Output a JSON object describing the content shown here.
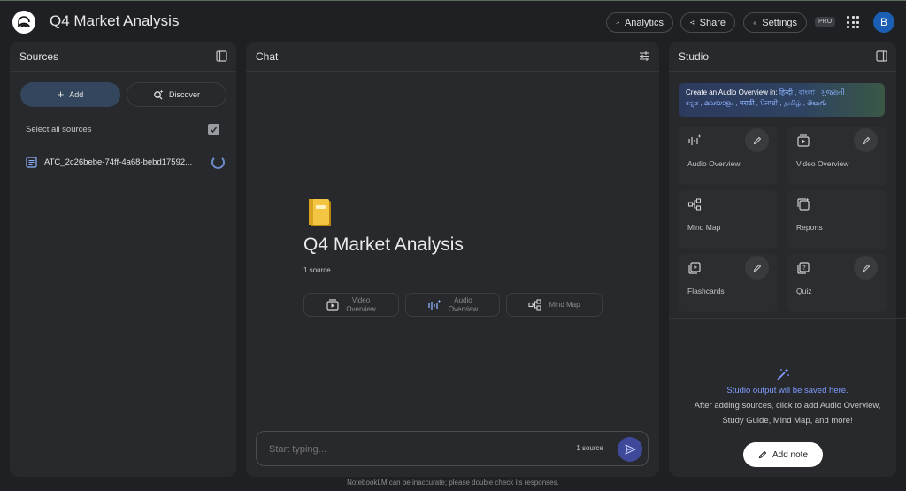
{
  "header": {
    "title": "Q4 Market Analysis",
    "analytics_label": "Analytics",
    "share_label": "Share",
    "settings_label": "Settings",
    "pro_badge": "PRO",
    "avatar_initial": "B"
  },
  "sources": {
    "title": "Sources",
    "add_label": "Add",
    "discover_label": "Discover",
    "select_all_label": "Select all sources",
    "items": [
      {
        "name": "ATC_2c26bebe-74ff-4a68-bebd17592..."
      }
    ]
  },
  "chat": {
    "title": "Chat",
    "notebook_title": "Q4 Market Analysis",
    "source_count": "1 source",
    "chips": {
      "video_line1": "Video",
      "video_line2": "Overview",
      "audio_line1": "Audio",
      "audio_line2": "Overview",
      "mindmap": "Mind Map"
    },
    "input_placeholder": "Start typing...",
    "input_source_count": "1 source"
  },
  "studio": {
    "title": "Studio",
    "banner_prefix": "Create an Audio Overview in:",
    "banner_languages_1": "हिन्दी , বাংলা , ગુજરાતી ,",
    "banner_languages_2": "ಕನ್ನಡ , മലയാളം , मराठी , ਪੰਜਾਬੀ , தமிழ் , తెలుగు",
    "tiles": {
      "audio_overview": "Audio Overview",
      "video_overview": "Video Overview",
      "mind_map": "Mind Map",
      "reports": "Reports",
      "flashcards": "Flashcards",
      "quiz": "Quiz"
    },
    "output_heading": "Studio output will be saved here.",
    "output_line1": "After adding sources, click to add Audio Overview,",
    "output_line2": "Study Guide, Mind Map, and more!",
    "add_note_label": "Add note"
  },
  "footer": {
    "disclaimer": "NotebookLM can be inaccurate; please double check its responses."
  },
  "colors": {
    "background": "#1f2023",
    "panel": "#28292c",
    "accent_blue": "#7e9cff",
    "send_button": "#3e4a99",
    "avatar": "#1a5fb4"
  }
}
